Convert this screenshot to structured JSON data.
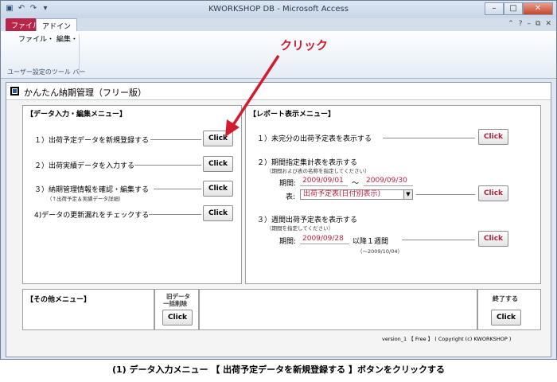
{
  "window": {
    "title": "KWORKSHOP DB - Microsoft Access"
  },
  "tabs": {
    "file": "ファイル",
    "addin": "アドイン"
  },
  "ribbon": {
    "menu": "ファイル・ 編集・",
    "group_label": "ユーザー設定のツール バー"
  },
  "form": {
    "title": "かんたん納期管理（フリー版）"
  },
  "data_menu": {
    "title": "【データ入力・編集メニュー】",
    "items": [
      {
        "label": "１）出荷予定データを新規登録する",
        "button": "Click"
      },
      {
        "label": "２）出荷実績データを入力する",
        "button": "Click"
      },
      {
        "label": "３）納期管理情報を確認・編集する",
        "sub": "（↑出荷予定＆実績データ詳細）",
        "button": "Click"
      },
      {
        "label": "4)データの更新漏れをチェックする",
        "button": "Click"
      }
    ]
  },
  "report_menu": {
    "title": "【レポート表示メニュー】",
    "item1": {
      "label": "１）未完分の出荷予定表を表示する",
      "button": "Click"
    },
    "item2": {
      "label": "２）期間指定集計表を表示する",
      "sub": "（期間および表の名称を指定してください）",
      "period_label": "期間:",
      "from": "2009/09/01",
      "sep": "〜",
      "to": "2009/09/30",
      "table_label": "表:",
      "table_value": "出荷予定表(日付別表示)",
      "button": "Click"
    },
    "item3": {
      "label": "３）週間出荷予定表を表示する",
      "sub": "（期間を指定してください）",
      "period_label": "期間:",
      "date": "2009/09/28",
      "suffix": "以降１週間",
      "range": "（〜2009/10/04）",
      "button": "Click"
    }
  },
  "other_menu": {
    "title": "【その他メニュー】",
    "old_delete_label_1": "旧データ",
    "old_delete_label_2": "一括削除",
    "button": "Click"
  },
  "exit": {
    "label": "終了する",
    "button": "Click"
  },
  "footer": "version_1 【 Free 】 ( Copyright (c) KWORKSHOP )",
  "annotation": "クリック",
  "caption": "(1) データ入力メニュー 【 出荷予定データを新規登録する 】ボタンをクリックする",
  "colors": {
    "accent_red": "#d21b2e",
    "file_tab": "#b7254a",
    "field_text": "#c0203c"
  }
}
